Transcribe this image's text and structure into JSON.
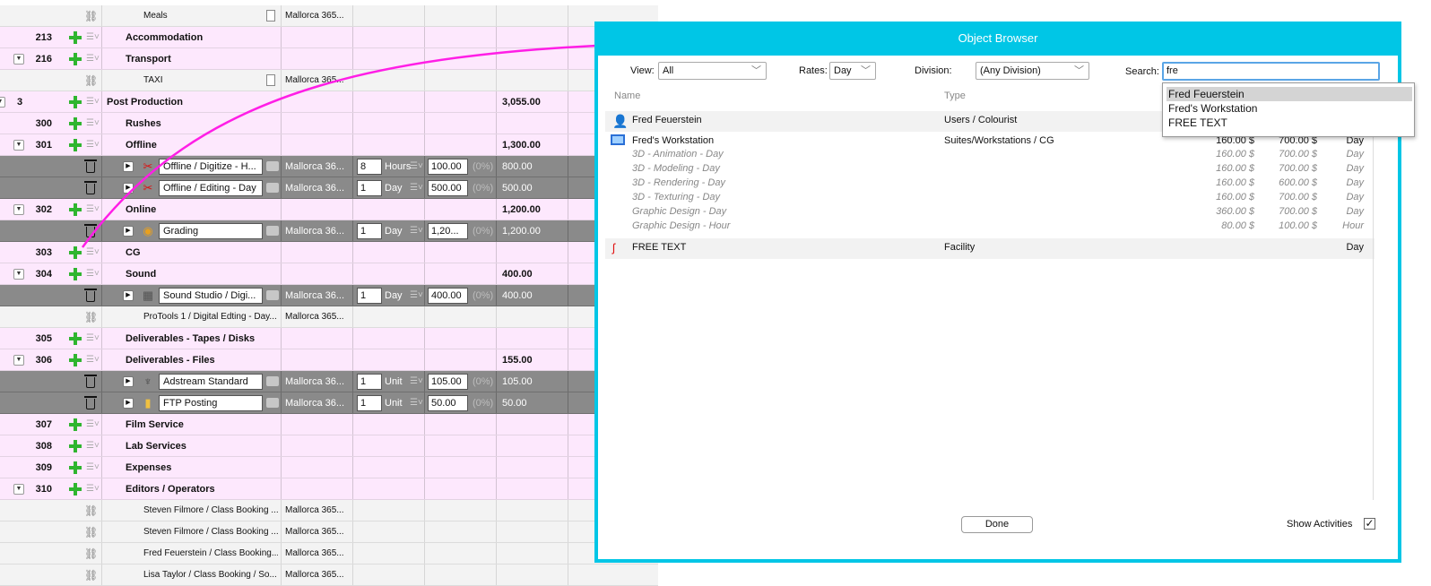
{
  "grid": {
    "rows": [
      {
        "kind": "sub",
        "text": "Meals",
        "location": "Mallorca 365..."
      },
      {
        "kind": "pink",
        "num": "213",
        "name": "Accommodation"
      },
      {
        "kind": "pink",
        "num": "216",
        "name": "Transport",
        "toggle": true
      },
      {
        "kind": "sub",
        "text": "TAXI",
        "location": "Mallorca 365..."
      },
      {
        "kind": "pink",
        "num": "3",
        "name": "Post Production",
        "amount": "3,055.00",
        "top": true
      },
      {
        "kind": "pink",
        "num": "300",
        "name": "Rushes"
      },
      {
        "kind": "pink",
        "num": "301",
        "name": "Offline",
        "amount": "1,300.00",
        "toggle": true
      },
      {
        "kind": "dark",
        "icon": "scissors-icon",
        "name": "Offline / Digitize - H...",
        "location": "Mallorca 36...",
        "qty": "8",
        "unit": "Hours",
        "rate": "100.00",
        "pct": "(0%)",
        "total": "800.00"
      },
      {
        "kind": "dark",
        "icon": "scissors-icon",
        "name": "Offline / Editing - Day",
        "location": "Mallorca 36...",
        "qty": "1",
        "unit": "Day",
        "rate": "500.00",
        "pct": "(0%)",
        "total": "500.00"
      },
      {
        "kind": "pink",
        "num": "302",
        "name": "Online",
        "amount": "1,200.00",
        "toggle": true
      },
      {
        "kind": "dark",
        "icon": "color-wheel-icon",
        "name": "Grading",
        "location": "Mallorca 36...",
        "qty": "1",
        "unit": "Day",
        "rate": "1,20...",
        "pct": "(0%)",
        "total": "1,200.00"
      },
      {
        "kind": "pink",
        "num": "303",
        "name": "CG"
      },
      {
        "kind": "pink",
        "num": "304",
        "name": "Sound",
        "amount": "400.00",
        "toggle": true
      },
      {
        "kind": "dark",
        "icon": "keyboard-icon",
        "name": "Sound Studio / Digi...",
        "location": "Mallorca 36...",
        "qty": "1",
        "unit": "Day",
        "rate": "400.00",
        "pct": "(0%)",
        "total": "400.00"
      },
      {
        "kind": "sub",
        "text": "ProTools 1 / Digital Edting - Day...",
        "location": "Mallorca 365..."
      },
      {
        "kind": "pink",
        "num": "305",
        "name": "Deliverables - Tapes / Disks"
      },
      {
        "kind": "pink",
        "num": "306",
        "name": "Deliverables - Files",
        "amount": "155.00",
        "toggle": true
      },
      {
        "kind": "dark",
        "icon": "antenna-icon",
        "name": "Adstream Standard",
        "location": "Mallorca 36...",
        "qty": "1",
        "unit": "Unit",
        "rate": "105.00",
        "pct": "(0%)",
        "total": "105.00"
      },
      {
        "kind": "dark",
        "icon": "folder-icon",
        "name": "FTP Posting",
        "location": "Mallorca 36...",
        "qty": "1",
        "unit": "Unit",
        "rate": "50.00",
        "pct": "(0%)",
        "total": "50.00"
      },
      {
        "kind": "pink",
        "num": "307",
        "name": "Film Service"
      },
      {
        "kind": "pink",
        "num": "308",
        "name": "Lab Services"
      },
      {
        "kind": "pink",
        "num": "309",
        "name": "Expenses"
      },
      {
        "kind": "pink",
        "num": "310",
        "name": "Editors / Operators",
        "toggle": true
      },
      {
        "kind": "sub",
        "text": "Steven Filmore / Class Booking ...",
        "location": "Mallorca 365..."
      },
      {
        "kind": "sub",
        "text": "Steven Filmore / Class Booking ...",
        "location": "Mallorca 365..."
      },
      {
        "kind": "sub",
        "text": "Fred Feuerstein / Class Booking...",
        "location": "Mallorca 365..."
      },
      {
        "kind": "sub",
        "text": "Lisa Taylor / Class Booking / So...",
        "location": "Mallorca 365..."
      }
    ]
  },
  "dialog": {
    "title": "Object Browser",
    "view_label": "View:",
    "view_value": "All",
    "rates_label": "Rates:",
    "rates_value": "Day",
    "division_label": "Division:",
    "division_value": "(Any Division)",
    "search_label": "Search:",
    "search_value": "fre",
    "col_name": "Name",
    "col_type": "Type",
    "suggestions": [
      "Fred Feuerstein",
      "Fred's Workstation",
      "FREE TEXT"
    ],
    "results": {
      "fred": {
        "name": "Fred Feuerstein",
        "type": "Users / Colourist"
      },
      "workstation": {
        "name": "Fred's Workstation",
        "type": "Suites/Workstations / CG",
        "rate1": "160.00 $",
        "rate2": "700.00 $",
        "unit": "Day",
        "activities": [
          {
            "name": "3D - Animation - Day",
            "rate1": "160.00 $",
            "rate2": "700.00 $",
            "unit": "Day"
          },
          {
            "name": "3D - Modeling - Day",
            "rate1": "160.00 $",
            "rate2": "700.00 $",
            "unit": "Day"
          },
          {
            "name": "3D - Rendering - Day",
            "rate1": "160.00 $",
            "rate2": "600.00 $",
            "unit": "Day"
          },
          {
            "name": "3D - Texturing - Day",
            "rate1": "160.00 $",
            "rate2": "700.00 $",
            "unit": "Day"
          },
          {
            "name": "Graphic Design - Day",
            "rate1": "360.00 $",
            "rate2": "700.00 $",
            "unit": "Day"
          },
          {
            "name": "Graphic Design - Hour",
            "rate1": "80.00 $",
            "rate2": "100.00 $",
            "unit": "Hour"
          }
        ]
      },
      "freetext": {
        "name": "FREE TEXT",
        "type": "Facility",
        "unit": "Day"
      }
    },
    "done_label": "Done",
    "show_activities_label": "Show Activities",
    "show_activities_checked": "✓"
  },
  "colors": {
    "dialog_border": "#00c6e6",
    "arrow": "#ff1ee6",
    "plus": "#2fb52f",
    "pink_row": "#fde8fd",
    "dark_row": "#8a8a8a"
  }
}
